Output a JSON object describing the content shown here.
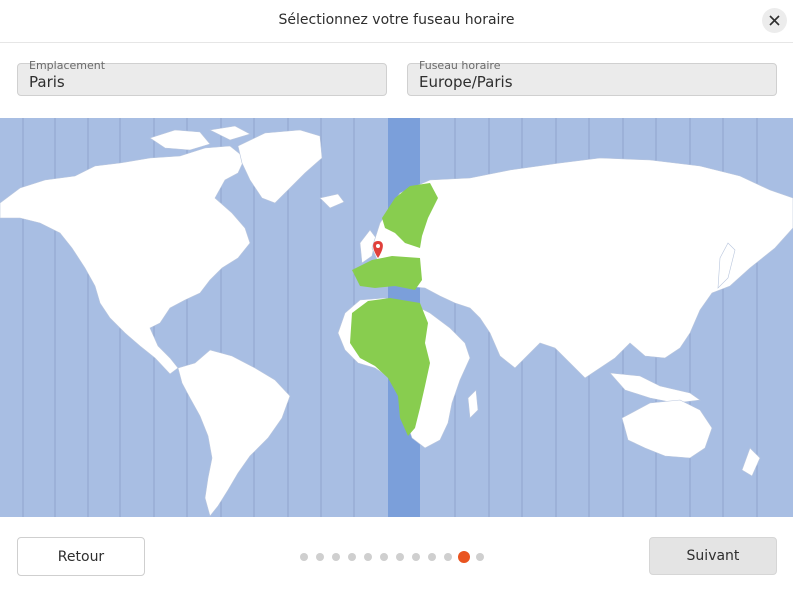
{
  "window": {
    "title": "Sélectionnez votre fuseau horaire",
    "close_icon": "close-icon"
  },
  "location": {
    "label": "Emplacement",
    "value": "Paris"
  },
  "timezone": {
    "label": "Fuseau horaire",
    "value": "Europe/Paris"
  },
  "map": {
    "selected_city": "Paris",
    "colors": {
      "ocean": "#a8bee3",
      "land": "#ffffff",
      "zone_highlight": "#7b9fda",
      "zone_land": "#88cd4f",
      "pin": "#e0403b"
    }
  },
  "navigation": {
    "back_label": "Retour",
    "next_label": "Suivant",
    "steps_total": 12,
    "current_step": 11,
    "accent": "#e95420"
  }
}
